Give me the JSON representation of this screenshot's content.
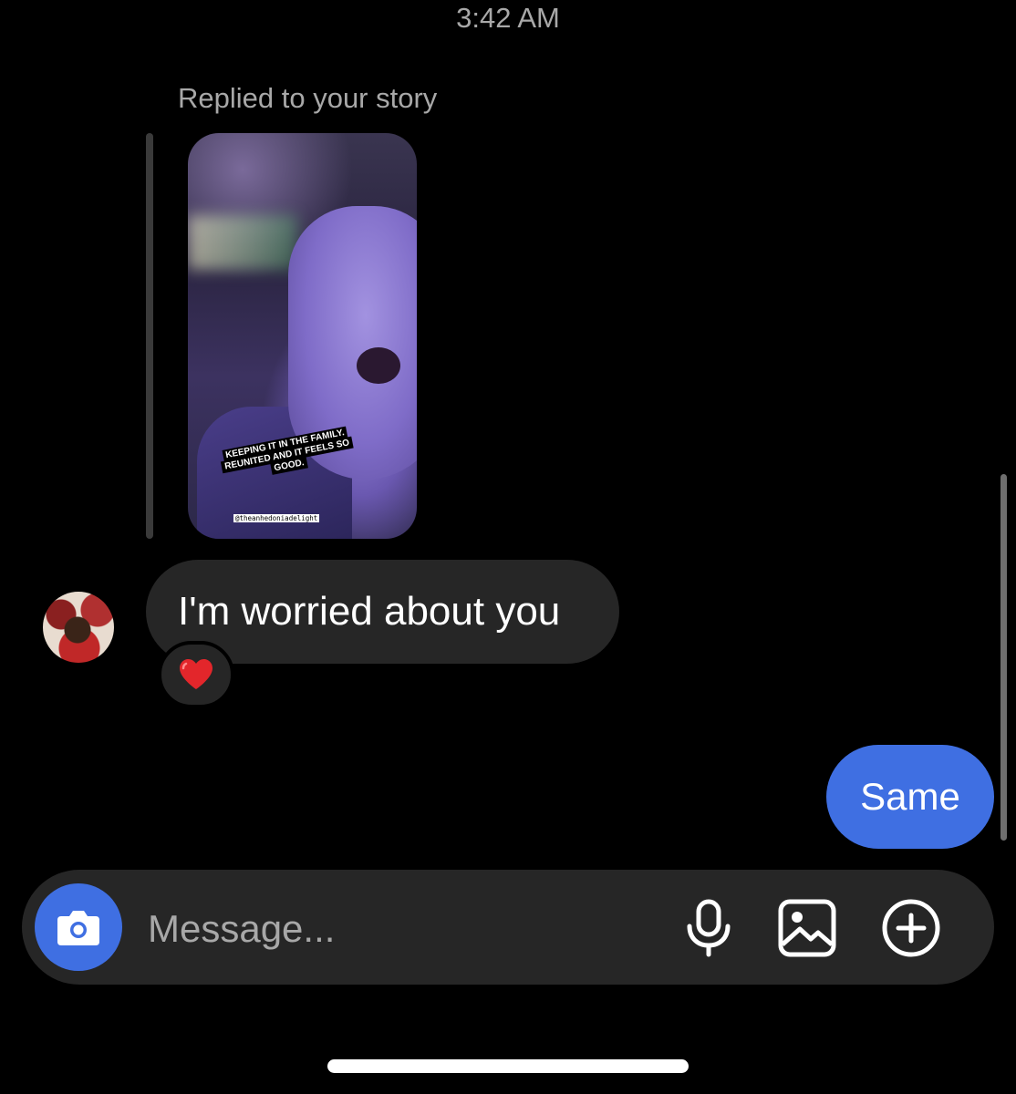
{
  "timestamp": "3:42 AM",
  "story_reply": {
    "label": "Replied to your story",
    "caption_line1": "KEEPING IT IN THE FAMILY.",
    "caption_line2": "REUNITED AND IT FEELS SO",
    "caption_line3": "GOOD.",
    "mention": "@theanhedoniadelight"
  },
  "messages": [
    {
      "direction": "incoming",
      "text": "I'm worried about you",
      "reaction": "❤️"
    },
    {
      "direction": "outgoing",
      "text": "Same"
    }
  ],
  "composer": {
    "placeholder": "Message...",
    "icons": [
      "camera-icon",
      "microphone-icon",
      "gallery-icon",
      "plus-circle-icon"
    ]
  },
  "colors": {
    "background": "#000000",
    "incoming_bubble": "#262626",
    "outgoing_bubble": "#3f6fe2",
    "secondary_text": "#a8a8a8"
  }
}
